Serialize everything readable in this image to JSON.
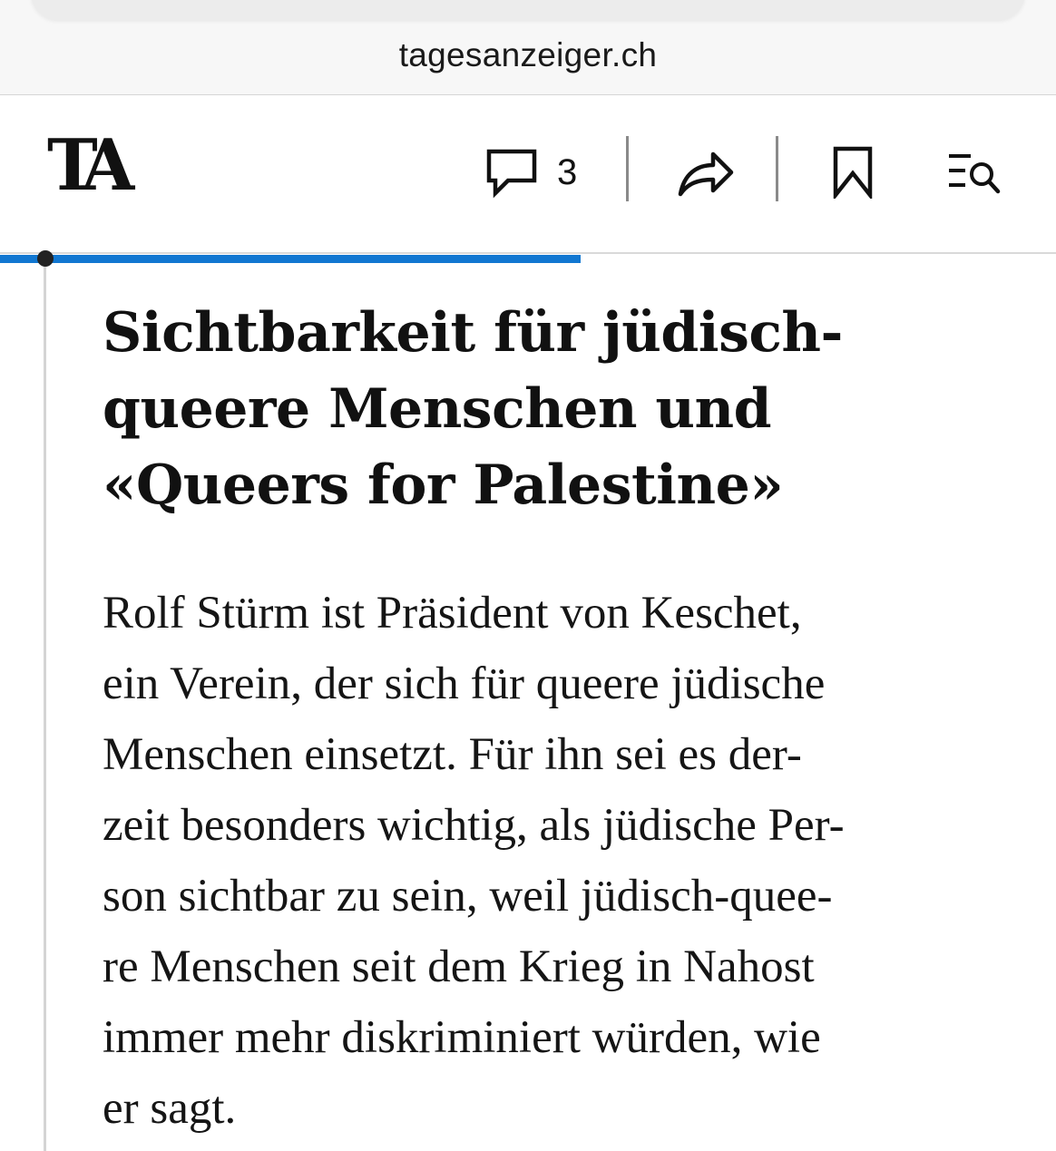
{
  "browser": {
    "domain": "tagesanzeiger.ch"
  },
  "header": {
    "logo_text": "TA",
    "comments_count": "3",
    "icons": {
      "comments": "speech-bubble-icon",
      "share": "share-arrow-icon",
      "bookmark": "bookmark-icon",
      "menu": "menu-search-icon"
    }
  },
  "progress": {
    "fraction": 0.55,
    "color": "#1177d1"
  },
  "article": {
    "headline": "Sichtbarkeit für jüdisch-queere Menschen und «Queers for Palestine»",
    "body_lines": [
      "Rolf Stürm ist Präsident von Keschet,",
      "ein Verein, der sich für queere jüdische",
      "Menschen einsetzt. Für ihn sei es der-",
      "zeit besonders wichtig, als jüdische Per-",
      "son sichtbar zu sein, weil jüdisch-quee-",
      "re Menschen seit dem Krieg in Nahost",
      "immer mehr diskriminiert würden, wie",
      "er sagt."
    ]
  }
}
